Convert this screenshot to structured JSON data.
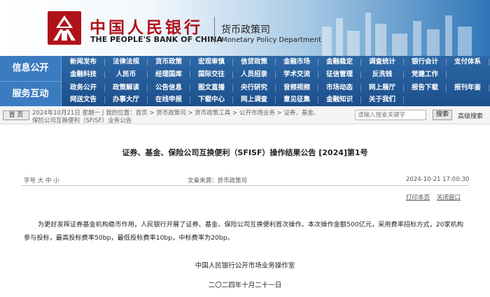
{
  "header": {
    "bank_name_cn": "中国人民银行",
    "bank_name_en": "THE PEOPLE'S BANK OF CHINA",
    "section_cn": "货币政策司",
    "section_en": "Monetary Policy Department",
    "logo_icon": "pboc-logo-icon",
    "brand_color": "#b0121a"
  },
  "nav": {
    "label_info": "信息公开",
    "label_service": "服务互动",
    "row1": [
      "新闻发布",
      "法律法规",
      "货币政策",
      "宏观审慎",
      "信贷政策",
      "金融市场",
      "金融稳定",
      "调查统计",
      "银行会计",
      "支付体系"
    ],
    "row2": [
      "金融科技",
      "人民币",
      "经理国库",
      "国际交往",
      "人员招录",
      "学术交流",
      "征信管理",
      "反洗钱",
      "党建工作"
    ],
    "row3": [
      "政务公开",
      "政策解读",
      "公告信息",
      "图文直播",
      "央行研究",
      "音频视频",
      "市场动态",
      "网上展厅",
      "报告下载",
      "报刊年鉴"
    ],
    "row4": [
      "网送文告",
      "办事大厅",
      "在线申报",
      "下载中心",
      "网上调查",
      "意见征集",
      "金融知识",
      "关于我们"
    ],
    "bg_color": "#1c4f8c"
  },
  "breadcrumb": {
    "home_button": "首 页",
    "line1": "2024年10月21日 星期一 | 我的位置：首页 > 货币政策司 > 货币政策工具 > 公开市场业务 > 证券、基金、",
    "line2": "保险公司互换便利（SFISF）业务公告"
  },
  "search": {
    "placeholder": "请输入搜索关键字",
    "button": "搜索",
    "advanced": "高级搜索"
  },
  "article": {
    "title": "证券、基金、保险公司互换便利（SFISF）操作结果公告 [2024]第1号",
    "font_size_label": "字号 大 中 小",
    "source": "文章来源：货币政策司",
    "date": "2024-10-21 17:00:30",
    "print": "打印本页",
    "close": "关闭窗口",
    "body": "为更好发挥证券基金机构稳市作用，人民银行开展了证券、基金、保险公司互换便利首次操作。本次操作金额500亿元，采用费率招标方式，20家机构参与投标，最高投标费率50bp，最低投标费率10bp，中标费率为20bp。",
    "signature": "中国人民银行公开市场业务操作室",
    "sign_date": "二〇二四年十月二十一日"
  }
}
